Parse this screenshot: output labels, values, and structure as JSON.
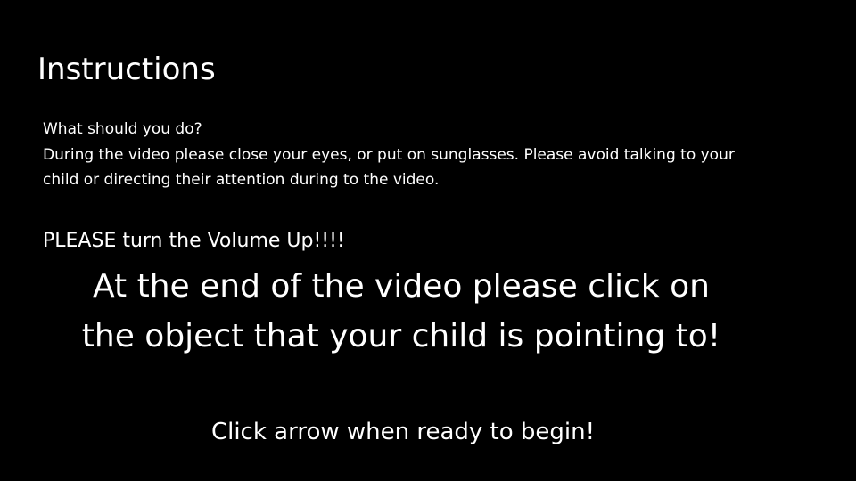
{
  "slide": {
    "title": "Instructions",
    "subheading": "What should you do?",
    "body": "During the video please close your eyes, or put on sunglasses. Please avoid talking to your child or directing their attention during to the video.",
    "volume_note": "PLEASE turn the Volume Up!!!!",
    "main_instruction_line1": "At the end of the video please click on",
    "main_instruction_line2": "the object that your child is pointing to!",
    "begin_note": "Click arrow when ready to begin!"
  },
  "colors": {
    "background": "#000000",
    "text": "#ffffff"
  }
}
